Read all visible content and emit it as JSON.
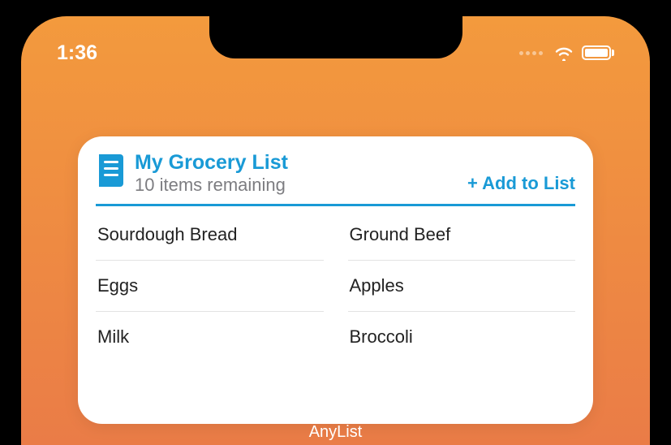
{
  "status": {
    "time": "1:36"
  },
  "widget": {
    "title": "My Grocery List",
    "subtitle": "10 items remaining",
    "add_label": "+ Add to List",
    "items": [
      "Sourdough Bread",
      "Ground Beef",
      "Eggs",
      "Apples",
      "Milk",
      "Broccoli"
    ]
  },
  "app_name": "AnyList",
  "colors": {
    "accent": "#199ad6"
  }
}
